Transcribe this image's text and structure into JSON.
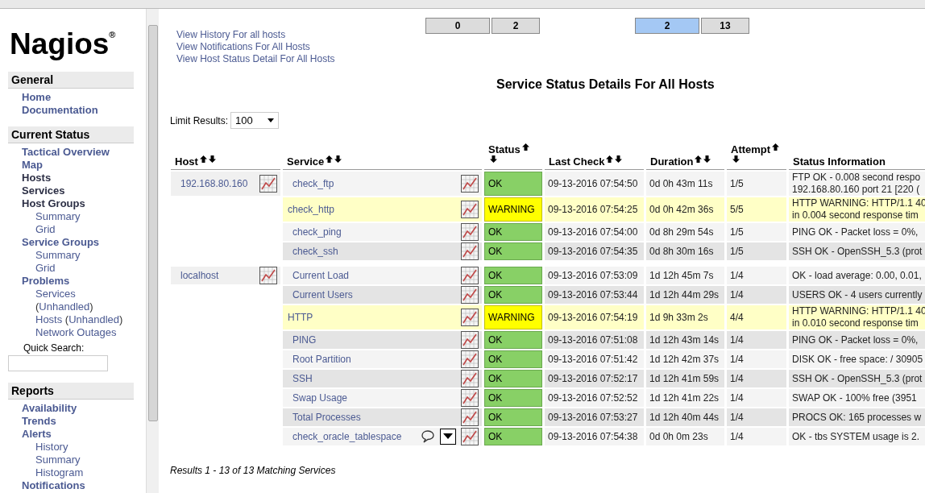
{
  "sidebar": {
    "logo": "Nagios$^{®}$",
    "sections": [
      {
        "title": "General",
        "items": [
          {
            "label": "Home",
            "visited": false
          },
          {
            "label": "Documentation",
            "visited": false
          }
        ]
      },
      {
        "title": "Current Status",
        "items": [
          {
            "label": "Tactical Overview",
            "visited": false
          },
          {
            "label": "Map",
            "visited": false
          },
          {
            "label": "Hosts",
            "visited": true
          },
          {
            "label": "Services",
            "visited": true
          },
          {
            "label": "Host Groups",
            "visited": true,
            "children": [
              {
                "parts": [
                  {
                    "text": "Summary",
                    "link": true
                  }
                ]
              },
              {
                "parts": [
                  {
                    "text": "Grid",
                    "link": true
                  }
                ]
              }
            ]
          },
          {
            "label": "Service Groups",
            "visited": false,
            "children": [
              {
                "parts": [
                  {
                    "text": "Summary",
                    "link": true
                  }
                ]
              },
              {
                "parts": [
                  {
                    "text": "Grid",
                    "link": true
                  }
                ]
              }
            ]
          },
          {
            "label": "Problems",
            "visited": false,
            "children": [
              {
                "parts": [
                  {
                    "text": "Services",
                    "link": true
                  }
                ]
              },
              {
                "parts": [
                  {
                    "text": "(",
                    "link": false
                  },
                  {
                    "text": "Unhandled",
                    "link": true
                  },
                  {
                    "text": ")",
                    "link": false
                  }
                ]
              },
              {
                "parts": [
                  {
                    "text": "Hosts",
                    "link": true
                  },
                  {
                    "text": " (",
                    "link": false
                  },
                  {
                    "text": "Unhandled",
                    "link": true
                  },
                  {
                    "text": ")",
                    "link": false
                  }
                ]
              },
              {
                "parts": [
                  {
                    "text": "Network Outages",
                    "link": true
                  }
                ]
              }
            ]
          }
        ],
        "quick_search": {
          "label": "Quick Search:"
        }
      },
      {
        "title": "Reports",
        "items": [
          {
            "label": "Availability",
            "visited": false
          },
          {
            "label": "Trends",
            "visited": false
          },
          {
            "label": "Alerts",
            "visited": false,
            "children": [
              {
                "parts": [
                  {
                    "text": "History",
                    "link": true
                  }
                ]
              },
              {
                "parts": [
                  {
                    "text": "Summary",
                    "link": true
                  }
                ]
              },
              {
                "parts": [
                  {
                    "text": "Histogram",
                    "link": true
                  }
                ]
              }
            ]
          },
          {
            "label": "Notifications",
            "visited": false
          }
        ]
      }
    ]
  },
  "links": [
    "View History For all hosts",
    "View Notifications For All Hosts",
    "View Host Status Detail For All Hosts"
  ],
  "host_totals": [
    {
      "count": "0",
      "selected": false
    },
    {
      "count": "2",
      "selected": false
    }
  ],
  "service_totals": [
    {
      "count": "2",
      "selected": true
    },
    {
      "count": "13",
      "selected": false
    }
  ],
  "title": "Service Status Details For All Hosts",
  "limit": {
    "label": "Limit Results:",
    "value": "100"
  },
  "table": {
    "columns": [
      {
        "label": "Host",
        "sortable": true
      },
      {
        "label": "Service",
        "sortable": true
      },
      {
        "label": "Status",
        "sortable": true
      },
      {
        "label": "Last Check",
        "sortable": true
      },
      {
        "label": "Duration",
        "sortable": true
      },
      {
        "label": "Attempt",
        "sortable": true
      },
      {
        "label": "Status Information",
        "sortable": false
      }
    ],
    "rows": [
      {
        "host": "192.168.80.160",
        "service": "check_ftp",
        "status": "OK",
        "last_check": "09-13-2016 07:54:50",
        "duration": "0d 0h 43m 11s",
        "attempt": "1/5",
        "info": [
          "FTP OK - 0.008 second respo",
          "192.168.80.160 port 21 [220 ("
        ],
        "comment": false,
        "actions_menu": false
      },
      {
        "service": "check_http",
        "status": "WARNING",
        "last_check": "09-13-2016 07:54:25",
        "duration": "0d 0h 42m 36s",
        "attempt": "5/5",
        "info": [
          "HTTP WARNING: HTTP/1.1 40",
          "in 0.004 second response tim"
        ],
        "comment": false,
        "actions_menu": false
      },
      {
        "service": "check_ping",
        "status": "OK",
        "last_check": "09-13-2016 07:54:00",
        "duration": "0d 8h 29m 54s",
        "attempt": "1/5",
        "info": [
          "PING OK - Packet loss = 0%,"
        ],
        "comment": false,
        "actions_menu": false
      },
      {
        "service": "check_ssh",
        "status": "OK",
        "last_check": "09-13-2016 07:54:35",
        "duration": "0d 8h 30m 16s",
        "attempt": "1/5",
        "info": [
          "SSH OK - OpenSSH_5.3 (prot"
        ],
        "comment": false,
        "actions_menu": false
      },
      {
        "host": "localhost",
        "service": "Current Load",
        "status": "OK",
        "last_check": "09-13-2016 07:53:09",
        "duration": "1d 12h 45m 7s",
        "attempt": "1/4",
        "info": [
          "OK - load average: 0.00, 0.01,"
        ],
        "comment": false,
        "actions_menu": false
      },
      {
        "service": "Current Users",
        "status": "OK",
        "last_check": "09-13-2016 07:53:44",
        "duration": "1d 12h 44m 29s",
        "attempt": "1/4",
        "info": [
          "USERS OK - 4 users currently"
        ],
        "comment": false,
        "actions_menu": false
      },
      {
        "service": "HTTP",
        "status": "WARNING",
        "last_check": "09-13-2016 07:54:19",
        "duration": "1d 9h 33m 2s",
        "attempt": "4/4",
        "info": [
          "HTTP WARNING: HTTP/1.1 40",
          "in 0.010 second response tim"
        ],
        "comment": false,
        "actions_menu": false
      },
      {
        "service": "PING",
        "status": "OK",
        "last_check": "09-13-2016 07:51:08",
        "duration": "1d 12h 43m 14s",
        "attempt": "1/4",
        "info": [
          "PING OK - Packet loss = 0%,"
        ],
        "comment": false,
        "actions_menu": false
      },
      {
        "service": "Root Partition",
        "status": "OK",
        "last_check": "09-13-2016 07:51:42",
        "duration": "1d 12h 42m 37s",
        "attempt": "1/4",
        "info": [
          "DISK OK - free space: / 30905"
        ],
        "comment": false,
        "actions_menu": false
      },
      {
        "service": "SSH",
        "status": "OK",
        "last_check": "09-13-2016 07:52:17",
        "duration": "1d 12h 41m 59s",
        "attempt": "1/4",
        "info": [
          "SSH OK - OpenSSH_5.3 (prot"
        ],
        "comment": false,
        "actions_menu": false
      },
      {
        "service": "Swap Usage",
        "status": "OK",
        "last_check": "09-13-2016 07:52:52",
        "duration": "1d 12h 41m 22s",
        "attempt": "1/4",
        "info": [
          "SWAP OK - 100% free (3951"
        ],
        "comment": false,
        "actions_menu": false
      },
      {
        "service": "Total Processes",
        "status": "OK",
        "last_check": "09-13-2016 07:53:27",
        "duration": "1d 12h 40m 44s",
        "attempt": "1/4",
        "info": [
          "PROCS OK: 165 processes w"
        ],
        "comment": false,
        "actions_menu": false
      },
      {
        "service": "check_oracle_tablespace",
        "status": "OK",
        "last_check": "09-13-2016 07:54:38",
        "duration": "0d 0h 0m 23s",
        "attempt": "1/4",
        "info": [
          "OK - tbs SYSTEM usage is 2."
        ],
        "comment": true,
        "actions_menu": true
      }
    ]
  },
  "results": "Results 1 - 13 of 13 Matching Services"
}
